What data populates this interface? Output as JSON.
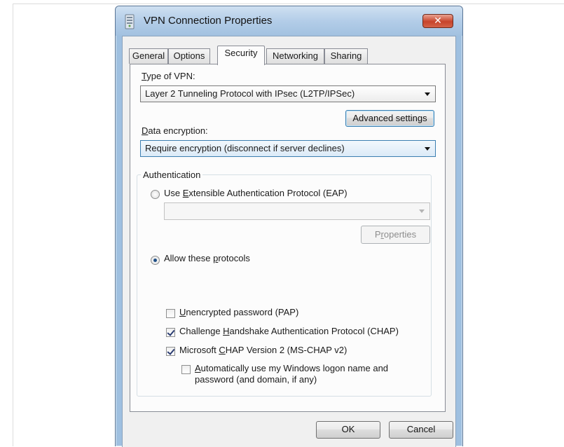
{
  "window": {
    "title": "VPN Connection Properties",
    "close_symbol": "✕",
    "icon": "vpn-connection-icon"
  },
  "tabs": [
    {
      "label": "General",
      "active": false
    },
    {
      "label": "Options",
      "active": false
    },
    {
      "label": "Security",
      "active": true
    },
    {
      "label": "Networking",
      "active": false
    },
    {
      "label": "Sharing",
      "active": false
    }
  ],
  "security": {
    "vpn_type": {
      "label_accel": "T",
      "label_rest": "ype of VPN:",
      "selected": "Layer 2 Tunneling Protocol with IPsec (L2TP/IPSec)"
    },
    "advanced_settings_label": "Advanced settings",
    "data_encryption": {
      "label_accel": "D",
      "label_rest": "ata encryption:",
      "selected": "Require encryption (disconnect if server declines)"
    },
    "authentication": {
      "group_title": "Authentication",
      "eap_option": {
        "before": "Use ",
        "accel": "E",
        "after": "xtensible Authentication Protocol (EAP)",
        "selected": false
      },
      "eap_dropdown_value": "",
      "properties_button": {
        "before": "P",
        "accel": "r",
        "after": "operties",
        "enabled": false
      },
      "allow_protocols": {
        "before": "Allow these ",
        "accel": "p",
        "after": "rotocols",
        "selected": true
      },
      "protocols": [
        {
          "before": "",
          "accel": "U",
          "after": "nencrypted password (PAP)",
          "checked": false
        },
        {
          "before": "Challenge ",
          "accel": "H",
          "after": "andshake Authentication Protocol (CHAP)",
          "checked": true
        },
        {
          "before": "Microsoft ",
          "accel": "C",
          "after": "HAP Version 2 (MS-CHAP v2)",
          "checked": true
        }
      ],
      "auto_logon": {
        "accel": "A",
        "line1_rest": "utomatically use my Windows logon name and",
        "line2": "password (and domain, if any)",
        "checked": false
      }
    }
  },
  "buttons": {
    "ok": "OK",
    "cancel": "Cancel"
  },
  "colors": {
    "highlight": "#f7dc52",
    "titlebar": "#b3cde8",
    "close_button": "#c7442c"
  }
}
